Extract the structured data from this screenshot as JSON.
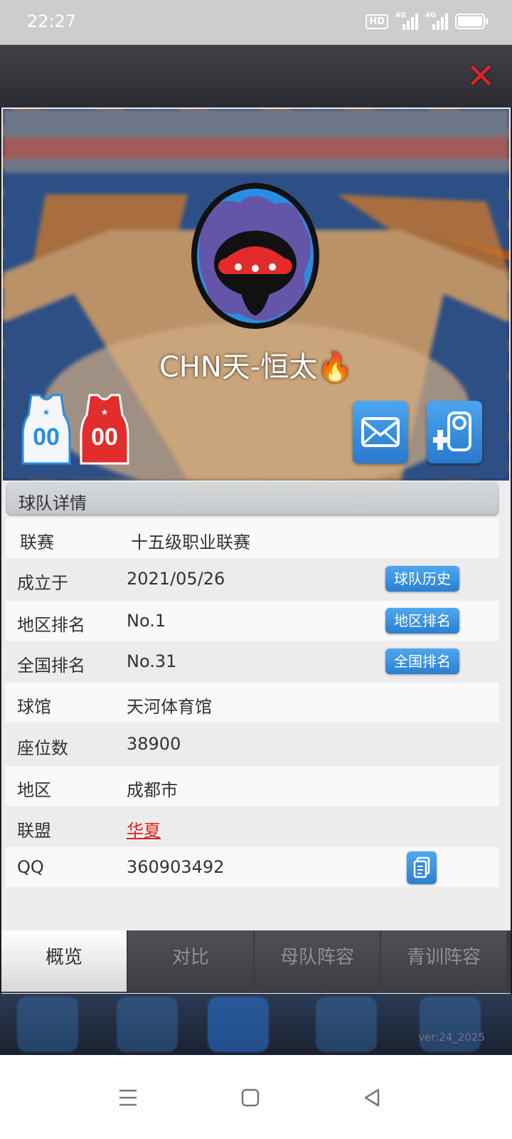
{
  "status_bar": {
    "time": "22:27",
    "hd": "HD",
    "signal1": "4G",
    "signal2": "4G"
  },
  "team": {
    "name": "CHN天-恒太🔥",
    "jersey_home_number": "00",
    "jersey_away_number": "00"
  },
  "hero_actions": {
    "message_icon": "envelope-icon",
    "follow_icon": "add-favorite-icon"
  },
  "details": {
    "section_title": "球队详情",
    "rows": [
      {
        "label": "联赛",
        "value": "十五级职业联赛"
      },
      {
        "label": "成立于",
        "value": "2021/05/26",
        "button": "球队历史"
      },
      {
        "label": "地区排名",
        "value": "No.1",
        "button": "地区排名"
      },
      {
        "label": "全国排名",
        "value": "No.31",
        "button": "全国排名"
      },
      {
        "label": "球馆",
        "value": "天河体育馆"
      },
      {
        "label": "座位数",
        "value": "38900"
      },
      {
        "label": "地区",
        "value": "成都市"
      },
      {
        "label": "联盟",
        "value": "华夏"
      },
      {
        "label": "QQ",
        "value": "360903492"
      }
    ]
  },
  "tabs": [
    "概览",
    "对比",
    "母队阵容",
    "青训阵容"
  ],
  "active_tab": 0,
  "version": "ver:24_2025",
  "colors": {
    "accent_blue": "#3a92e0",
    "close_red": "#d32828",
    "alliance_red": "#e02020"
  }
}
